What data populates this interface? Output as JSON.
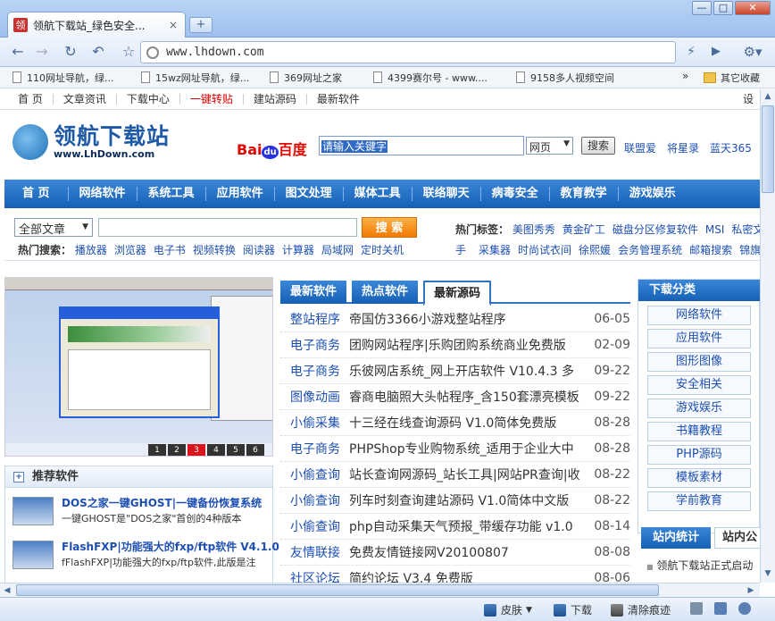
{
  "browser": {
    "tab_title": "领航下载站_绿色安全...",
    "tab_favicon": "领",
    "close_tab": "×",
    "new_tab": "+",
    "url": "www.lhdown.com",
    "window_buttons": [
      "—",
      "□",
      "✕"
    ]
  },
  "bookmarks": [
    "110网址导航，绿...",
    "15wz网址导航，绿...",
    "369网址之家",
    "4399赛尔号 - www....",
    "9158多人视频空间"
  ],
  "bookmarks_more": "»",
  "bookmarks_other": "其它收藏",
  "topnav": [
    "首 页",
    "文章资讯",
    "下载中心",
    "一键转贴",
    "建站源码",
    "最新软件"
  ],
  "topnav_right": "设",
  "logo": {
    "cn": "领航下载站",
    "en": "www.LhDown.com"
  },
  "baidu": {
    "bai": "Bai",
    "du_logo": "du",
    "cn": "百度"
  },
  "search": {
    "value": "请输入关键字",
    "select": "网页",
    "button": "搜索"
  },
  "header_links": [
    "联盟爱",
    "将星录",
    "蓝天365",
    "封"
  ],
  "mainnav": [
    "首 页",
    "网络软件",
    "系统工具",
    "应用软件",
    "图文处理",
    "媒体工具",
    "联络聊天",
    "病毒安全",
    "教育教学",
    "游戏娱乐"
  ],
  "site_search": {
    "category": "全部文章",
    "button": "搜 索"
  },
  "hot_search": {
    "label": "热门搜索：",
    "items": [
      "播放器",
      "浏览器",
      "电子书",
      "视频转换",
      "阅读器",
      "计算器",
      "局域网",
      "定时关机"
    ]
  },
  "hot_tags": {
    "label": "热门标签：",
    "items": [
      "美图秀秀",
      "黄金矿工",
      "磁盘分区修复软件",
      "MSI",
      "私密文"
    ]
  },
  "hot_tags2": [
    "手",
    "采集器",
    "时尚试衣间",
    "徐熙媛",
    "会务管理系统",
    "邮箱搜索",
    "锦旗"
  ],
  "slideshow_pager": [
    "1",
    "2",
    "3",
    "4",
    "5",
    "6"
  ],
  "slideshow_active": 3,
  "recommended": {
    "title": "推荐软件",
    "items": [
      {
        "title": "DOS之家一键GHOST|一键备份恢复系统",
        "desc": "一键GHOST是\"DOS之家\"首创的4种版本"
      },
      {
        "title": "FlashFXP|功能强大的fxp/ftp软件 V4.1.0",
        "desc": "fFlashFXP|功能强大的fxp/ftp软件,此版是注"
      }
    ]
  },
  "mid_tabs": [
    "最新软件",
    "热点软件",
    "最新源码"
  ],
  "mid_rows": [
    {
      "cat": "整站程序",
      "title": "帝国仿3366小游戏整站程序",
      "date": "06-05"
    },
    {
      "cat": "电子商务",
      "title": "团购网站程序|乐购团购系统商业免费版",
      "date": "02-09"
    },
    {
      "cat": "电子商务",
      "title": "乐彼网店系统_网上开店软件 V10.4.3 多",
      "date": "09-22"
    },
    {
      "cat": "图像动画",
      "title": "睿商电脑照大头帖程序_含150套漂亮模板",
      "date": "09-22"
    },
    {
      "cat": "小偷采集",
      "title": "十三经在线查询源码 V1.0简体免费版",
      "date": "08-28"
    },
    {
      "cat": "电子商务",
      "title": "PHPShop专业购物系统_适用于企业大中",
      "date": "08-28"
    },
    {
      "cat": "小偷查询",
      "title": "站长查询网源码_站长工具|网站PR查询|收",
      "date": "08-22"
    },
    {
      "cat": "小偷查询",
      "title": "列车时刻查询建站源码 V1.0简体中文版",
      "date": "08-22"
    },
    {
      "cat": "小偷查询",
      "title": "php自动采集天气预报_带缓存功能 v1.0",
      "date": "08-14"
    },
    {
      "cat": "友情联接",
      "title": "免费友情链接网V20100807",
      "date": "08-08"
    },
    {
      "cat": "社区论坛",
      "title": "简约论坛 V3.4 免费版",
      "date": "08-06"
    }
  ],
  "downloads": {
    "title": "下载分类",
    "items": [
      "网络软件",
      "应用软件",
      "图形图像",
      "安全相关",
      "游戏娱乐",
      "书籍教程",
      "PHP源码",
      "模板素材",
      "学前教育"
    ]
  },
  "stats": {
    "tab1": "站内统计",
    "tab2": "站内公",
    "notice": "领航下载站正式启动"
  },
  "statusbar": {
    "skin": "皮肤",
    "download": "下载",
    "clear": "清除痕迹"
  }
}
